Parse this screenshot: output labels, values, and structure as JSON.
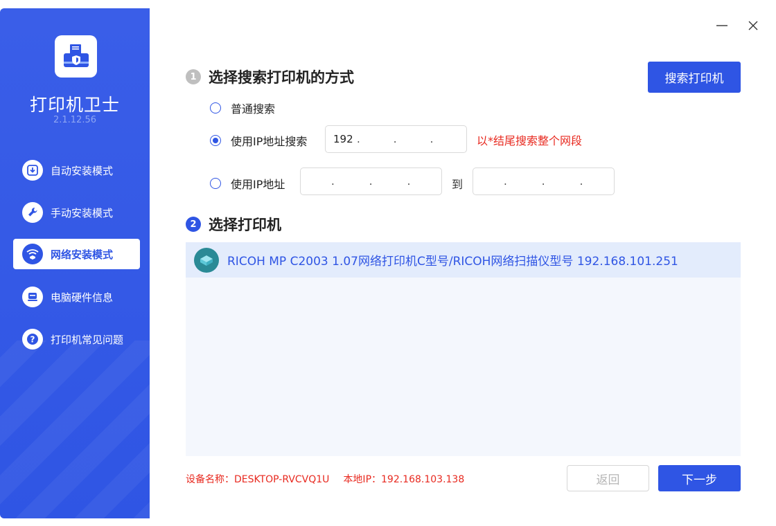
{
  "app": {
    "title": "打印机卫士",
    "version": "2.1.12.56"
  },
  "sidebar": {
    "items": [
      {
        "label": "自动安装模式",
        "icon": "download-icon",
        "active": false
      },
      {
        "label": "手动安装模式",
        "icon": "wrench-icon",
        "active": false
      },
      {
        "label": "网络安装模式",
        "icon": "network-icon",
        "active": true
      },
      {
        "label": "电脑硬件信息",
        "icon": "hardware-icon",
        "active": false
      },
      {
        "label": "打印机常见问题",
        "icon": "question-icon",
        "active": false
      }
    ]
  },
  "window_controls": {
    "minimize": "minimize-icon",
    "close": "close-icon"
  },
  "step1": {
    "number": "1",
    "title": "选择搜索打印机的方式",
    "search_button": "搜索打印机",
    "options": {
      "normal": {
        "label": "普通搜索",
        "checked": false
      },
      "ip_search": {
        "label": "使用IP地址搜索",
        "checked": true,
        "ip": [
          "192",
          "",
          "",
          ""
        ],
        "hint": "以*结尾搜索整个网段"
      },
      "ip_range": {
        "label": "使用IP地址",
        "checked": false,
        "from": [
          "",
          "",
          "",
          ""
        ],
        "to_label": "到",
        "to": [
          "",
          "",
          "",
          ""
        ]
      }
    }
  },
  "step2": {
    "number": "2",
    "title": "选择打印机",
    "printers": [
      {
        "name": "RICOH MP C2003 1.07网络打印机C型号/RICOH网络扫描仪型号 192.168.101.251",
        "selected": true
      }
    ]
  },
  "footer": {
    "device_name": "设备名称：DESKTOP-RVCVQ1U",
    "local_ip": "本地IP：192.168.103.138",
    "back_button": "返回",
    "next_button": "下一步"
  },
  "colors": {
    "primary": "#2f55e4",
    "warning": "#e8291f",
    "list_bg": "#f4f7fd",
    "selected_row": "#e3ecfc"
  }
}
